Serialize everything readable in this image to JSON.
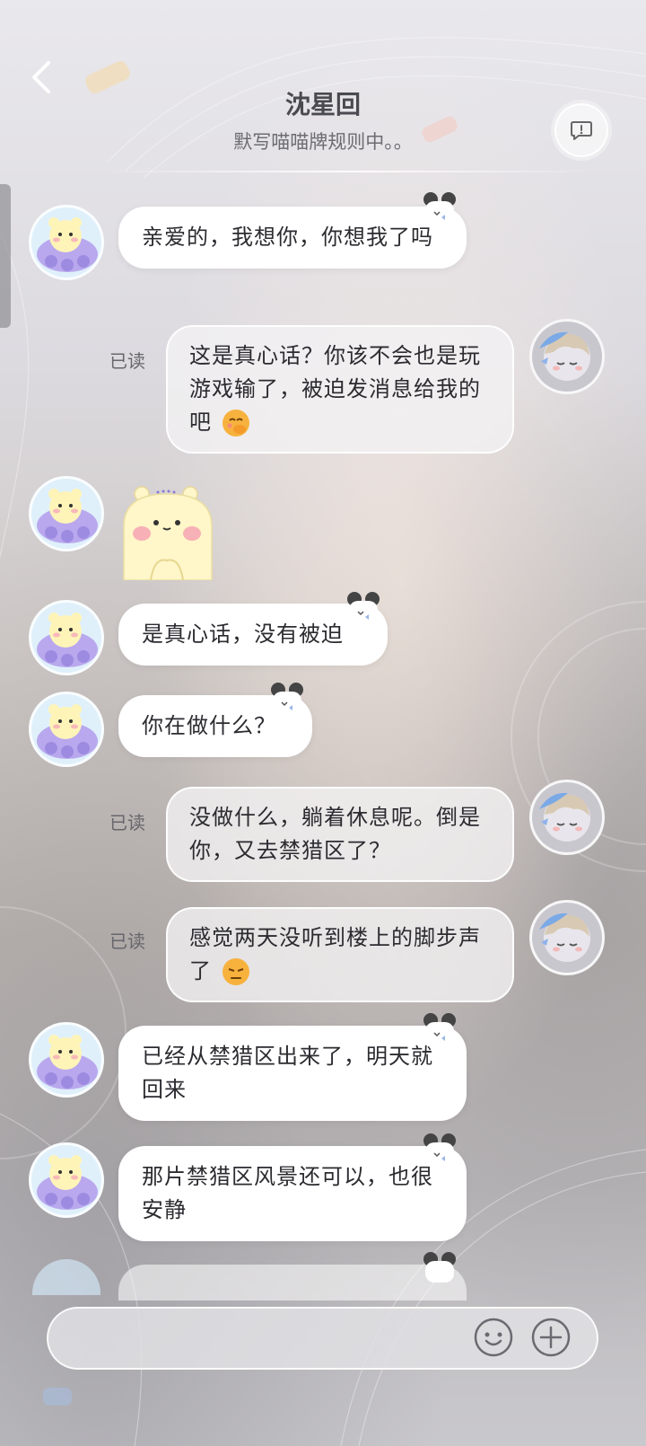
{
  "header": {
    "title": "沈星回",
    "subtitle": "默写喵喵牌规则中。。"
  },
  "messages": [
    {
      "side": "in",
      "text": "亲爱的，我想你，你想我了吗"
    },
    {
      "side": "out",
      "read": "已读",
      "text": "这是真心话？你该不会也是玩游戏输了，被迫发消息给我的吧",
      "emoji": "shy-face-emoji"
    },
    {
      "side": "in",
      "sticker": "yellow-bear-sticker"
    },
    {
      "side": "in",
      "text": "是真心话，没有被迫"
    },
    {
      "side": "in",
      "text": "你在做什么？"
    },
    {
      "side": "out",
      "read": "已读",
      "text": "没做什么，躺着休息呢。倒是你，又去禁猎区了？"
    },
    {
      "side": "out",
      "read": "已读",
      "text": "感觉两天没听到楼上的脚步声了",
      "emoji": "pouting-face-emoji"
    },
    {
      "side": "in",
      "text": "已经从禁猎区出来了，明天就回来"
    },
    {
      "side": "in",
      "text": "那片禁猎区风景还可以，也很安静"
    }
  ],
  "input": {
    "value": "",
    "placeholder": ""
  },
  "icons": {
    "back": "chevron-left-icon",
    "header_action": "chat-bubble-icon",
    "emoji": "smile-icon",
    "add": "plus-icon"
  }
}
